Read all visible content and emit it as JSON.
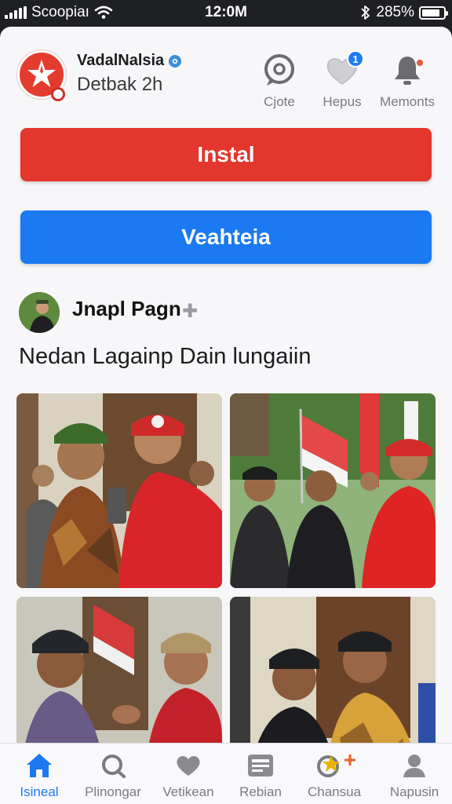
{
  "status_bar": {
    "carrier": "Scoopiaı",
    "time": "12:0M",
    "battery": "285%",
    "battery_level": 0.85
  },
  "header": {
    "account_name": "VadalNalsia",
    "account_sub": "Detbak 2h",
    "actions": [
      {
        "label": "Cjote",
        "icon": "chat-bubble-icon"
      },
      {
        "label": "Hepus",
        "icon": "heart-icon",
        "badge": "1"
      },
      {
        "label": "Memonts",
        "icon": "bell-icon"
      }
    ]
  },
  "buttons": {
    "install_label": "Instal",
    "follow_label": "Veahteia"
  },
  "post": {
    "author": "Jnapl Pagn",
    "author_action": "✚",
    "caption": "Nedan Lagainp Dain lungaiin"
  },
  "bottom_nav": [
    {
      "label": "Isineal",
      "icon": "home-icon",
      "active": true
    },
    {
      "label": "Plinongar",
      "icon": "search-icon"
    },
    {
      "label": "Vetikean",
      "icon": "heart-icon"
    },
    {
      "label": "Rebian",
      "icon": "news-icon"
    },
    {
      "label": "Chansua",
      "icon": "activity-icon"
    },
    {
      "label": "Napusin",
      "icon": "profile-icon"
    }
  ],
  "colors": {
    "install": "#e3362d",
    "follow": "#1b79f2",
    "active_nav": "#1b79f2"
  }
}
